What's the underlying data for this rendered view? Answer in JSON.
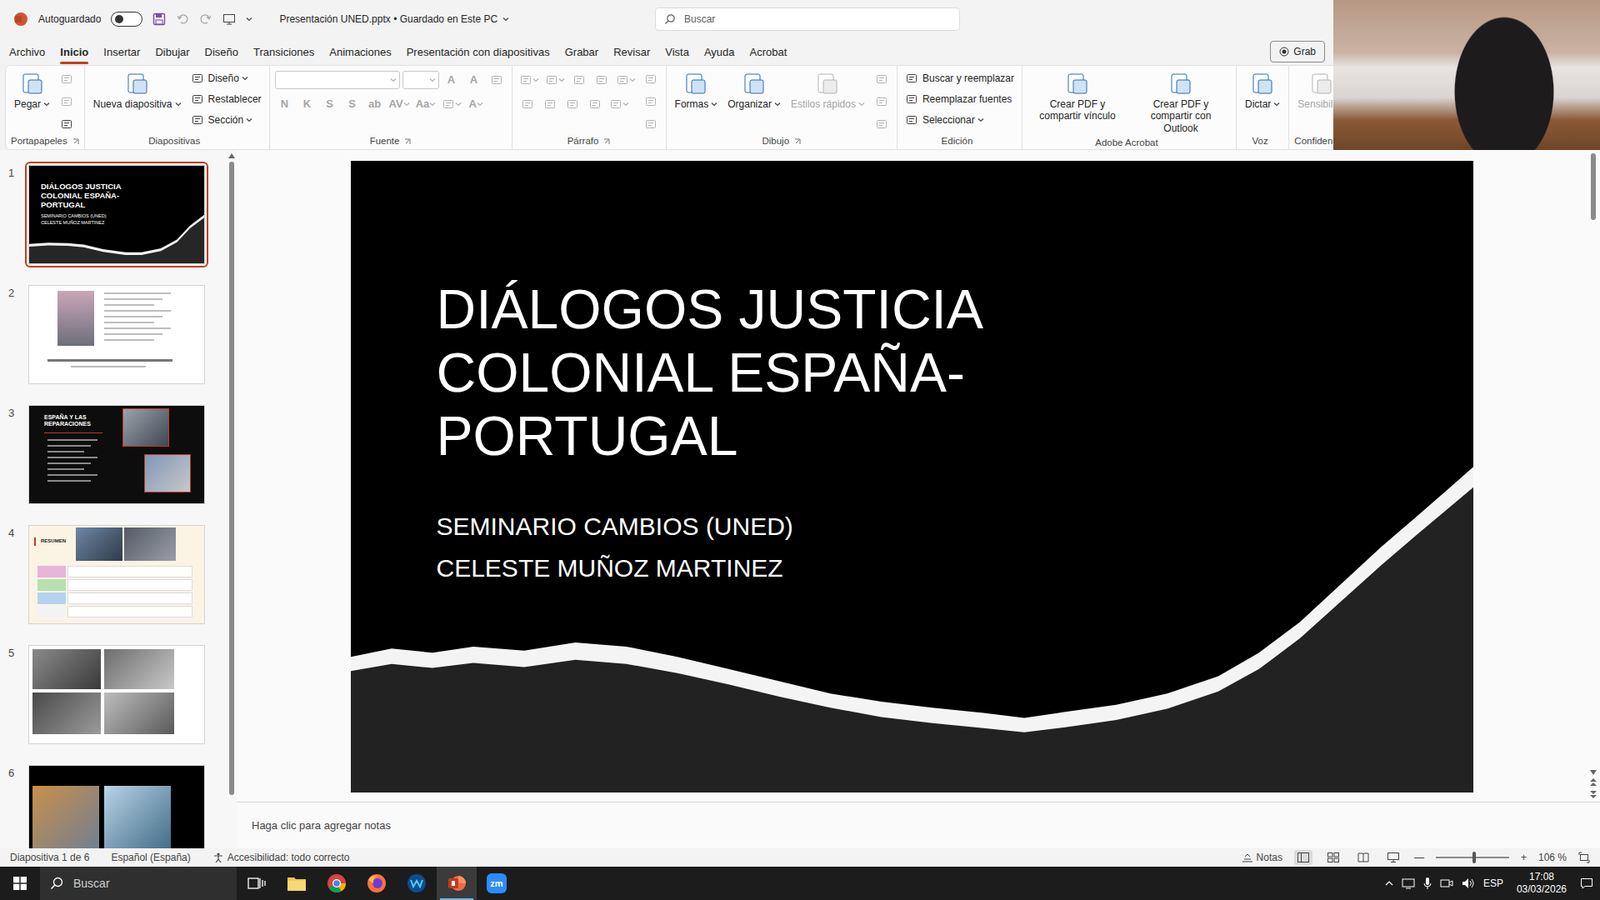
{
  "window": {
    "filename": "Presentación UNED.pptx • Guardado en Este PC",
    "autosave": {
      "label": "Autoguardado",
      "on": false
    },
    "search": {
      "placeholder": "Buscar"
    }
  },
  "menu": {
    "tabs": [
      {
        "label": "Archivo",
        "selected": false
      },
      {
        "label": "Inicio",
        "selected": true
      },
      {
        "label": "Insertar",
        "selected": false
      },
      {
        "label": "Dibujar",
        "selected": false
      },
      {
        "label": "Diseño",
        "selected": false
      },
      {
        "label": "Transiciones",
        "selected": false
      },
      {
        "label": "Animaciones",
        "selected": false
      },
      {
        "label": "Presentación con diapositivas",
        "selected": false
      },
      {
        "label": "Grabar",
        "selected": false
      },
      {
        "label": "Revisar",
        "selected": false
      },
      {
        "label": "Vista",
        "selected": false
      },
      {
        "label": "Ayuda",
        "selected": false
      },
      {
        "label": "Acrobat",
        "selected": false
      }
    ],
    "record_button": "Grab"
  },
  "ribbon": {
    "groups": [
      {
        "label": "Portapapeles",
        "launcher": true,
        "controls": [
          {
            "kind": "large",
            "label": "Pegar",
            "dropdown": true,
            "disabled": false
          },
          {
            "kind": "icons",
            "items": [
              {
                "disabled": true
              },
              {
                "disabled": true
              },
              {
                "disabled": false
              }
            ]
          }
        ]
      },
      {
        "label": "Diapositivas",
        "launcher": false,
        "controls": [
          {
            "kind": "large",
            "label": "Nueva diapositiva",
            "dropdown": true,
            "disabled": false
          },
          {
            "kind": "list",
            "items": [
              {
                "label": "Diseño",
                "dropdown": true,
                "disabled": false
              },
              {
                "label": "Restablecer",
                "dropdown": false,
                "disabled": false
              },
              {
                "label": "Sección",
                "dropdown": true,
                "disabled": false
              }
            ]
          }
        ]
      },
      {
        "label": "Fuente",
        "launcher": true,
        "controls": [
          {
            "kind": "grid",
            "rows": [
              [
                {
                  "kind": "field-wide",
                  "disabled": true
                },
                {
                  "kind": "field-narrow",
                  "disabled": true
                },
                {
                  "kind": "button",
                  "label": "A",
                  "dropdown": false,
                  "disabled": true
                },
                {
                  "kind": "button",
                  "label": "A",
                  "dropdown": false,
                  "disabled": true
                },
                {
                  "kind": "button",
                  "label": "",
                  "dropdown": false,
                  "disabled": true
                }
              ],
              [
                {
                  "kind": "button",
                  "label": "N",
                  "dropdown": false,
                  "disabled": true
                },
                {
                  "kind": "button",
                  "label": "K",
                  "dropdown": false,
                  "disabled": true
                },
                {
                  "kind": "button",
                  "label": "S",
                  "dropdown": false,
                  "disabled": true
                },
                {
                  "kind": "button",
                  "label": "S",
                  "dropdown": false,
                  "disabled": true
                },
                {
                  "kind": "button",
                  "label": "ab",
                  "dropdown": false,
                  "disabled": true
                },
                {
                  "kind": "button",
                  "label": "AV",
                  "dropdown": true,
                  "disabled": true
                },
                {
                  "kind": "button",
                  "label": "Aa",
                  "dropdown": true,
                  "disabled": true
                },
                {
                  "kind": "button",
                  "label": "",
                  "dropdown": true,
                  "disabled": true
                },
                {
                  "kind": "button",
                  "label": "A",
                  "dropdown": true,
                  "disabled": true
                }
              ]
            ]
          }
        ]
      },
      {
        "label": "Párrafo",
        "launcher": true,
        "controls": [
          {
            "kind": "grid",
            "rows": [
              [
                {
                  "kind": "button",
                  "label": "",
                  "dropdown": true,
                  "disabled": true
                },
                {
                  "kind": "button",
                  "label": "",
                  "dropdown": true,
                  "disabled": true
                },
                {
                  "kind": "button",
                  "label": "",
                  "dropdown": false,
                  "disabled": true
                },
                {
                  "kind": "button",
                  "label": "",
                  "dropdown": false,
                  "disabled": true
                },
                {
                  "kind": "button",
                  "label": "",
                  "dropdown": true,
                  "disabled": true
                }
              ],
              [
                {
                  "kind": "button",
                  "label": "",
                  "dropdown": false,
                  "disabled": true
                },
                {
                  "kind": "button",
                  "label": "",
                  "dropdown": false,
                  "disabled": true
                },
                {
                  "kind": "button",
                  "label": "",
                  "dropdown": false,
                  "disabled": true
                },
                {
                  "kind": "button",
                  "label": "",
                  "dropdown": false,
                  "disabled": true
                },
                {
                  "kind": "button",
                  "label": "",
                  "dropdown": true,
                  "disabled": true
                }
              ]
            ]
          },
          {
            "kind": "icons",
            "items": [
              {
                "disabled": true
              },
              {
                "disabled": true
              },
              {
                "disabled": true
              }
            ]
          }
        ]
      },
      {
        "label": "Dibujo",
        "launcher": true,
        "controls": [
          {
            "kind": "large",
            "label": "Formas",
            "dropdown": true,
            "disabled": false
          },
          {
            "kind": "large",
            "label": "Organizar",
            "dropdown": true,
            "disabled": false
          },
          {
            "kind": "large",
            "label": "Estilos rápidos",
            "dropdown": true,
            "disabled": true
          },
          {
            "kind": "icons",
            "items": [
              {
                "disabled": true
              },
              {
                "disabled": true
              },
              {
                "disabled": true
              }
            ]
          }
        ]
      },
      {
        "label": "Edición",
        "launcher": false,
        "controls": [
          {
            "kind": "list",
            "items": [
              {
                "label": "Buscar y reemplazar",
                "dropdown": false,
                "disabled": false
              },
              {
                "label": "Reemplazar fuentes",
                "dropdown": false,
                "disabled": false
              },
              {
                "label": "Seleccionar",
                "dropdown": true,
                "disabled": false
              }
            ]
          }
        ]
      },
      {
        "label": "Adobe Acrobat",
        "launcher": false,
        "controls": [
          {
            "kind": "large",
            "label": "Crear PDF y compartir vínculo",
            "dropdown": false,
            "disabled": false
          },
          {
            "kind": "large",
            "label": "Crear PDF y compartir con Outlook",
            "dropdown": false,
            "disabled": false
          }
        ]
      },
      {
        "label": "Voz",
        "launcher": false,
        "controls": [
          {
            "kind": "large",
            "label": "Dictar",
            "dropdown": true,
            "disabled": false
          }
        ]
      },
      {
        "label": "Confidencialid",
        "launcher": false,
        "controls": [
          {
            "kind": "large",
            "label": "Sensibilida",
            "dropdown": false,
            "disabled": true
          }
        ]
      }
    ]
  },
  "thumbnails": [
    {
      "number": "1",
      "selected": true,
      "kind": "title-dark",
      "texts": [
        "DIÁLOGOS JUSTICIA COLONIAL ESPAÑA-PORTUGAL",
        "SEMINARIO CAMBIOS (UNED)",
        "CELESTE MUÑOZ MARTINEZ"
      ]
    },
    {
      "number": "2",
      "selected": false,
      "kind": "photo-white",
      "texts": []
    },
    {
      "number": "3",
      "selected": false,
      "kind": "list-dark",
      "texts": [
        "ESPAÑA Y LAS REPARACIONES"
      ]
    },
    {
      "number": "4",
      "selected": false,
      "kind": "summary-cream",
      "texts": [
        "RESUMEN"
      ]
    },
    {
      "number": "5",
      "selected": false,
      "kind": "photos-white",
      "texts": []
    },
    {
      "number": "6",
      "selected": false,
      "kind": "photos-dark",
      "texts": []
    }
  ],
  "slide": {
    "title": "DIÁLOGOS JUSTICIA COLONIAL ESPAÑA-PORTUGAL",
    "subtitle_lines": [
      "SEMINARIO CAMBIOS (UNED)",
      "CELESTE MUÑOZ MARTINEZ"
    ]
  },
  "notes": {
    "placeholder": "Haga clic para agregar notas"
  },
  "status_bar": {
    "slide_info": "Diapositiva 1 de 6",
    "language": "Español (España)",
    "accessibility": "Accesibilidad: todo correcto",
    "notes_button": "Notas",
    "view_buttons": [
      {
        "kind": "normal",
        "selected": true
      },
      {
        "kind": "sorter",
        "selected": false
      },
      {
        "kind": "reading",
        "selected": false
      },
      {
        "kind": "slideshow",
        "selected": false
      }
    ],
    "zoom": {
      "minus": "—",
      "plus": "+",
      "level": 0.52,
      "reading": "106 %"
    }
  },
  "taskbar": {
    "search": {
      "placeholder": "Buscar"
    },
    "apps": [
      {
        "kind": "taskview",
        "selected": false
      },
      {
        "kind": "explorer",
        "selected": false
      },
      {
        "kind": "chrome",
        "selected": false
      },
      {
        "kind": "firefox",
        "selected": false
      },
      {
        "kind": "webex",
        "selected": false
      },
      {
        "kind": "powerpoint",
        "selected": true
      },
      {
        "kind": "zoom",
        "selected": false,
        "label": "zm"
      }
    ],
    "tray": {
      "language": "ESP",
      "time": "17:08",
      "date": "03/03/2026"
    }
  }
}
